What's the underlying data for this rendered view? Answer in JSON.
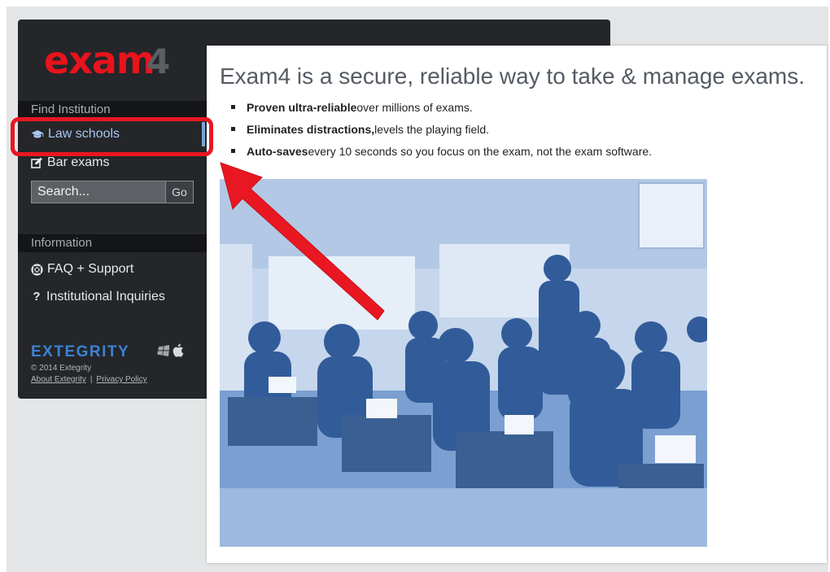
{
  "app": {
    "logo_text": "exam4",
    "brand_color": "#e8131b",
    "accent_color": "#7ba4d6",
    "annotation_color": "#e81721"
  },
  "sidebar": {
    "find_institution_header": "Find Institution",
    "items": [
      {
        "label": "Law schools",
        "icon": "graduation-cap-icon",
        "active": true
      },
      {
        "label": "Bar exams",
        "icon": "edit-icon",
        "active": false
      }
    ],
    "search": {
      "placeholder": "Search...",
      "go_label": "Go"
    },
    "information_header": "Information",
    "info_items": [
      {
        "label": "FAQ + Support",
        "icon": "lifebuoy-icon"
      },
      {
        "label": "Institutional Inquiries",
        "icon": "question-icon"
      }
    ],
    "footer": {
      "brand": "EXTEGRITY",
      "copyright": "© 2014 Extegrity",
      "links": [
        "About Extegrity",
        "Privacy Policy"
      ],
      "separator": "|",
      "platform_icons": [
        "windows-icon",
        "apple-icon"
      ]
    }
  },
  "main": {
    "headline": "Exam4 is a secure, reliable way to take & manage exams.",
    "bullets": [
      {
        "bold": "Proven ultra-reliable",
        "rest": " over millions of exams."
      },
      {
        "bold": "Eliminates distractions,",
        "rest": " levels the playing field."
      },
      {
        "bold": "Auto-saves",
        "rest": " every 10 seconds so you focus on the exam, not the exam software."
      }
    ],
    "photo_icon": "historic-typing-class-photo",
    "photo_tint": "#8fb0da"
  }
}
